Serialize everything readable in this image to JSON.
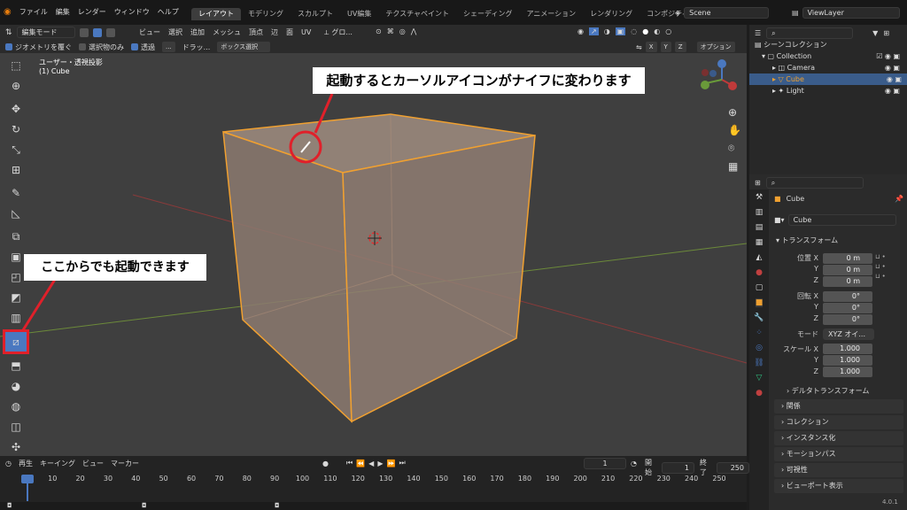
{
  "menus": [
    "ファイル",
    "編集",
    "レンダー",
    "ウィンドウ",
    "ヘルプ"
  ],
  "tabs": [
    "レイアウト",
    "モデリング",
    "スカルプト",
    "UV編集",
    "テクスチャペイント",
    "シェーディング",
    "アニメーション",
    "レンダリング",
    "コンポジティング"
  ],
  "scene_name": "Scene",
  "viewlayer": "ViewLayer",
  "header": {
    "mode": "編集モード",
    "menu": [
      "ビュー",
      "選択",
      "追加",
      "メッシュ",
      "頂点",
      "辺",
      "面",
      "UV"
    ],
    "transform": "グロ..."
  },
  "header3": {
    "gizmo": "ジオメトリを覆ぐ",
    "selected_only": "選択物のみ",
    "transparent": "透過",
    "dots": "...",
    "drag": "ドラッ...",
    "box_select": "ボックス選択",
    "x": "X",
    "y": "Y",
    "z": "Z",
    "options": "オプション"
  },
  "viewport": {
    "view_label": "ユーザー・透視投影",
    "object_label": "(1) Cube"
  },
  "annotations": {
    "top": "起動するとカーソルアイコンがナイフに変わります",
    "left": "ここからでも起動できます"
  },
  "colors": {
    "accent": "#4a78c0",
    "highlight_red": "#e0202a",
    "cube_edge": "#f0a030",
    "cube_face": "#8a7a70"
  },
  "timeline": {
    "play": "再生",
    "keying": "キーイング",
    "view": "ビュー",
    "marker": "マーカー",
    "current": "1",
    "start_label": "開始",
    "start": "1",
    "end_label": "終了",
    "end": "250",
    "ticks": [
      "1",
      "10",
      "20",
      "30",
      "40",
      "50",
      "60",
      "70",
      "80",
      "90",
      "100",
      "110",
      "120",
      "130",
      "140",
      "150",
      "160",
      "170",
      "180",
      "190",
      "200",
      "210",
      "220",
      "230",
      "240",
      "250"
    ]
  },
  "outliner": {
    "scene_collection": "シーンコレクション",
    "collection": "Collection",
    "items": [
      "Camera",
      "Cube",
      "Light"
    ]
  },
  "properties": {
    "object_name": "Cube",
    "data_name": "Cube",
    "transform": "トランスフォーム",
    "location": "位置 X",
    "y": "Y",
    "z": "Z",
    "loc": [
      "0 m",
      "0 m",
      "0 m"
    ],
    "rotation": "回転 X",
    "rot": [
      "0°",
      "0°",
      "0°"
    ],
    "mode_label": "モード",
    "mode": "XYZ オイ...",
    "scale": "スケール X",
    "scl": [
      "1.000",
      "1.000",
      "1.000"
    ],
    "delta": "デルタトランスフォーム",
    "sections": [
      "関係",
      "コレクション",
      "インスタンス化",
      "モーションパス",
      "可視性",
      "ビューポート表示"
    ]
  },
  "version": "4.0.1"
}
